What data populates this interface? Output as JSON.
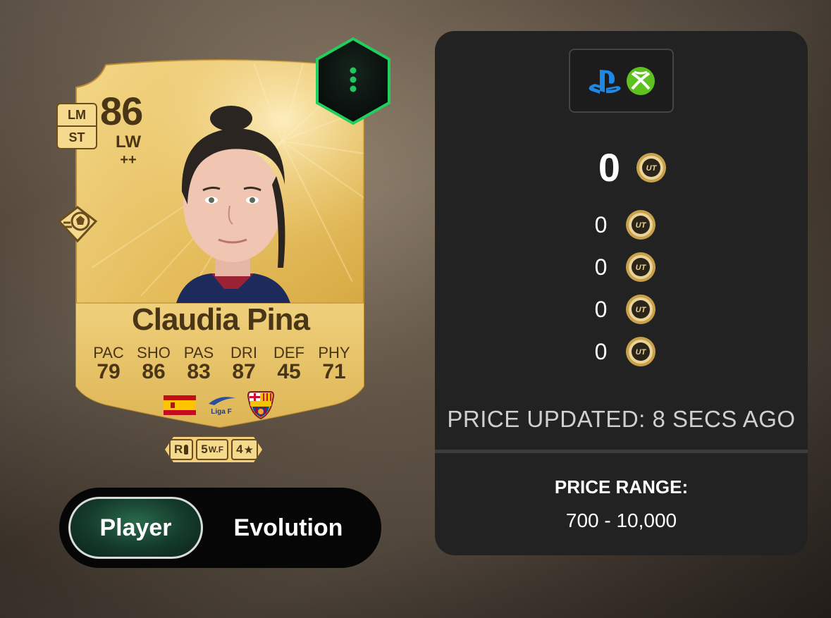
{
  "card": {
    "rating": "86",
    "alt_positions": [
      "LM",
      "ST"
    ],
    "position": "LW",
    "position_plus": "++",
    "name": "Claudia Pina",
    "stats": [
      {
        "label": "PAC",
        "value": "79"
      },
      {
        "label": "SHO",
        "value": "86"
      },
      {
        "label": "PAS",
        "value": "83"
      },
      {
        "label": "DRI",
        "value": "87"
      },
      {
        "label": "DEF",
        "value": "45"
      },
      {
        "label": "PHY",
        "value": "71"
      }
    ],
    "nation": "spain-flag",
    "league_logo_text": "Liga F",
    "club": "fc-barcelona-crest",
    "foot": "R",
    "weak_foot": "5",
    "weak_foot_label": "W.F",
    "skill_moves": "4",
    "skill_star": "★"
  },
  "toggle": {
    "player_label": "Player",
    "evolution_label": "Evolution",
    "active": "Player"
  },
  "price_panel": {
    "platforms": [
      "playstation-icon",
      "xbox-icon"
    ],
    "current_price": "0",
    "other_prices": [
      "0",
      "0",
      "0",
      "0"
    ],
    "coin_text": "UT",
    "updated_text": "PRICE UPDATED: 8 SECS AGO",
    "range_label": "PRICE RANGE:",
    "range_value": "700 - 10,000"
  },
  "colors": {
    "card_gold": "#e7c063",
    "card_text": "#4a3516",
    "panel_bg": "#222222",
    "accent_green": "#22c55e",
    "playstation_blue": "#1e88e5",
    "xbox_green": "#5dc21e"
  }
}
